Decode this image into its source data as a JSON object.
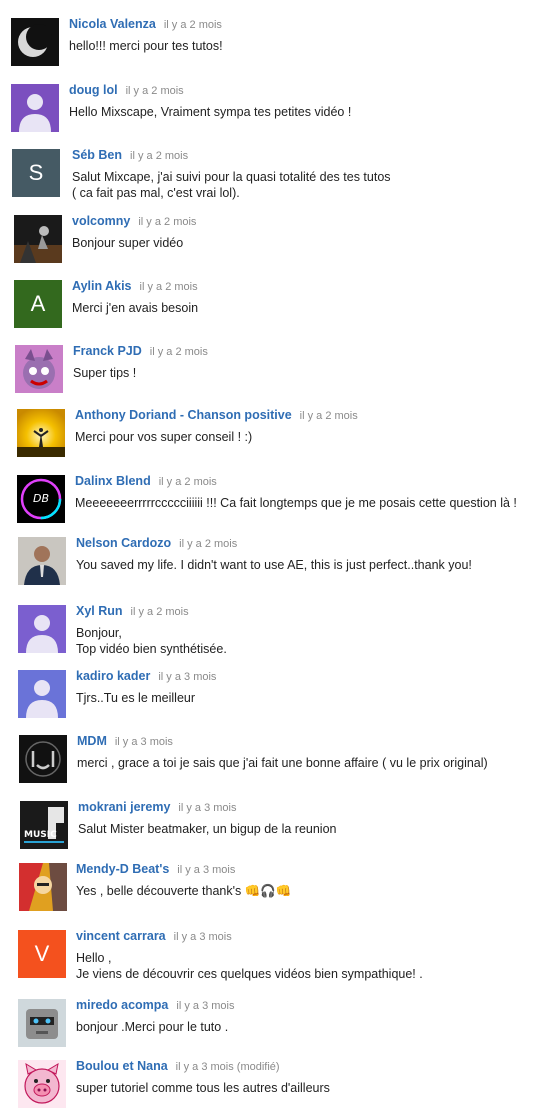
{
  "comments": [
    {
      "author": "Nicola Valenza",
      "time": "il y a 2 mois",
      "lines": [
        "hello!!! merci pour tes tutos!"
      ],
      "avatar": {
        "kind": "moon",
        "color": "#111111"
      }
    },
    {
      "author": "doug lol",
      "time": "il y a 2 mois",
      "lines": [
        "Hello Mixscape, Vraiment sympa tes petites vidéo !"
      ],
      "avatar": {
        "kind": "default",
        "color": "#7b4fbf"
      }
    },
    {
      "author": "Séb Ben",
      "time": "il y a 2 mois",
      "lines": [
        "Salut Mixcape, j'ai suivi pour la quasi totalité des tes tutos",
        "( ca fait pas mal, c'est vrai lol)."
      ],
      "avatar": {
        "kind": "letter",
        "letter": "S",
        "color": "#455a64"
      }
    },
    {
      "author": "volcomny",
      "time": "il y a 2 mois",
      "lines": [
        "Bonjour super vidéo"
      ],
      "avatar": {
        "kind": "photo-dark",
        "color": "#1a1a1a"
      }
    },
    {
      "author": "Aylin Akis",
      "time": "il y a 2 mois",
      "lines": [
        "Merci j'en avais besoin"
      ],
      "avatar": {
        "kind": "letter",
        "letter": "A",
        "color": "#33691e"
      }
    },
    {
      "author": "Franck PJD",
      "time": "il y a 2 mois",
      "lines": [
        "Super tips !"
      ],
      "avatar": {
        "kind": "cartoon",
        "color": "#9a6fb0"
      }
    },
    {
      "author": "Anthony Doriand - Chanson positive",
      "time": "il y a 2 mois",
      "lines": [
        "Merci pour vos super conseil ! :)"
      ],
      "avatar": {
        "kind": "sunset",
        "color": "#f5c000"
      }
    },
    {
      "author": "Dalinx Blend",
      "time": "il y a 2 mois",
      "lines": [
        "Meeeeeeerrrrrccccciiiiii !!! Ca fait longtemps que je me posais cette question là !"
      ],
      "avatar": {
        "kind": "db-logo",
        "color": "#000000"
      }
    },
    {
      "author": "Nelson Cardozo",
      "time": "il y a 2 mois",
      "lines": [
        "You saved my life. I didn't want to use AE, this is just perfect..thank you!"
      ],
      "avatar": {
        "kind": "person",
        "color": "#c9c6c0"
      }
    },
    {
      "author": "Xyl Run",
      "time": "il y a 2 mois",
      "lines": [
        "Bonjour,",
        "Top vidéo bien synthétisée."
      ],
      "avatar": {
        "kind": "default",
        "color": "#7b5fcf"
      }
    },
    {
      "author": "kadiro kader",
      "time": "il y a 3 mois",
      "lines": [
        "Tjrs..Tu es le meilleur"
      ],
      "avatar": {
        "kind": "default",
        "color": "#6a73d8"
      }
    },
    {
      "author": "MDM",
      "time": "il y a 3 mois",
      "lines": [
        "merci , grace a toi je sais que j'ai fait une bonne affaire ( vu le prix original)"
      ],
      "avatar": {
        "kind": "mdm-logo",
        "color": "#111111"
      }
    },
    {
      "author": "mokrani jeremy",
      "time": "il y a 3 mois",
      "lines": [
        "Salut Mister beatmaker, un bigup de la reunion"
      ],
      "avatar": {
        "kind": "music-logo",
        "color": "#1a1a1a"
      }
    },
    {
      "author": "Mendy-D Beat's",
      "time": "il y a 3 mois",
      "lines": [
        "Yes , belle découverte  thank's 👊🎧👊"
      ],
      "avatar": {
        "kind": "art",
        "color": "#e0a020"
      }
    },
    {
      "author": "vincent carrara",
      "time": "il y a 3 mois",
      "lines": [
        "Hello ,",
        "Je viens de découvrir ces quelques vidéos bien sympathique! ."
      ],
      "avatar": {
        "kind": "letter",
        "letter": "V",
        "color": "#f4511e"
      }
    },
    {
      "author": "miredo acompa",
      "time": "il y a 3 mois",
      "lines": [
        "bonjour .Merci pour le tuto ."
      ],
      "avatar": {
        "kind": "robot",
        "color": "#8d8d8d"
      }
    },
    {
      "author": "Boulou et Nana",
      "time": "il y a 3 mois (modifié)",
      "lines": [
        "super tutoriel comme tous les autres d'ailleurs"
      ],
      "avatar": {
        "kind": "pig",
        "color": "#f3b7d0"
      }
    }
  ]
}
